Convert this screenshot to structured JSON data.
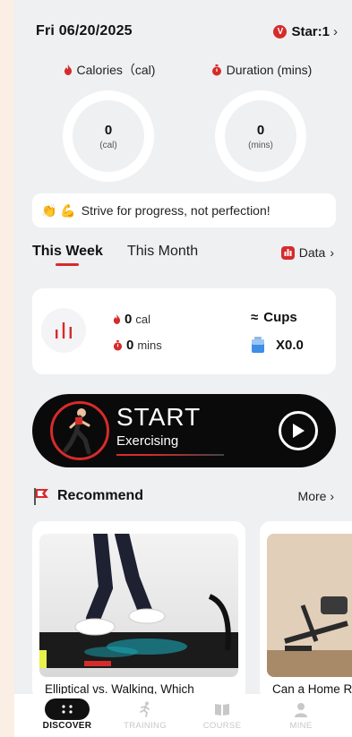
{
  "header": {
    "date": "Fri 06/20/2025",
    "star_badge": "V",
    "star_label": "Star:1",
    "chevron": "›"
  },
  "stats": {
    "calories": {
      "label": "Calories（cal)",
      "value": "0",
      "unit": "(cal)",
      "icon": "flame-icon"
    },
    "duration": {
      "label": "Duration (mins)",
      "value": "0",
      "unit": "(mins)",
      "icon": "stopwatch-icon"
    }
  },
  "quote": {
    "emoji": "👏 💪",
    "text": "Strive for progress, not perfection!"
  },
  "tabs": {
    "week": "This Week",
    "month": "This Month",
    "data_label": "Data",
    "chevron": "›"
  },
  "summary": {
    "cal_value": "0",
    "cal_unit": "cal",
    "mins_value": "0",
    "mins_unit": "mins",
    "cups_prefix": "≈",
    "cups_label": "Cups",
    "cups_value": "X0.0"
  },
  "start": {
    "title": "START",
    "subtitle": "Exercising"
  },
  "recommend": {
    "title": "Recommend",
    "more": "More",
    "chevron": "›",
    "cards": [
      {
        "title": "Elliptical vs. Walking, Which"
      },
      {
        "title": "Can a Home R"
      }
    ]
  },
  "nav": [
    {
      "label": "DISCOVER",
      "active": true,
      "icon": "grid-dots-icon"
    },
    {
      "label": "TRAINING",
      "active": false,
      "icon": "runner-icon"
    },
    {
      "label": "COURSE",
      "active": false,
      "icon": "book-icon"
    },
    {
      "label": "MINE",
      "active": false,
      "icon": "person-icon"
    }
  ],
  "colors": {
    "accent": "#d62b2b",
    "background": "#eef0f2",
    "banner": "#0a0a0a"
  }
}
